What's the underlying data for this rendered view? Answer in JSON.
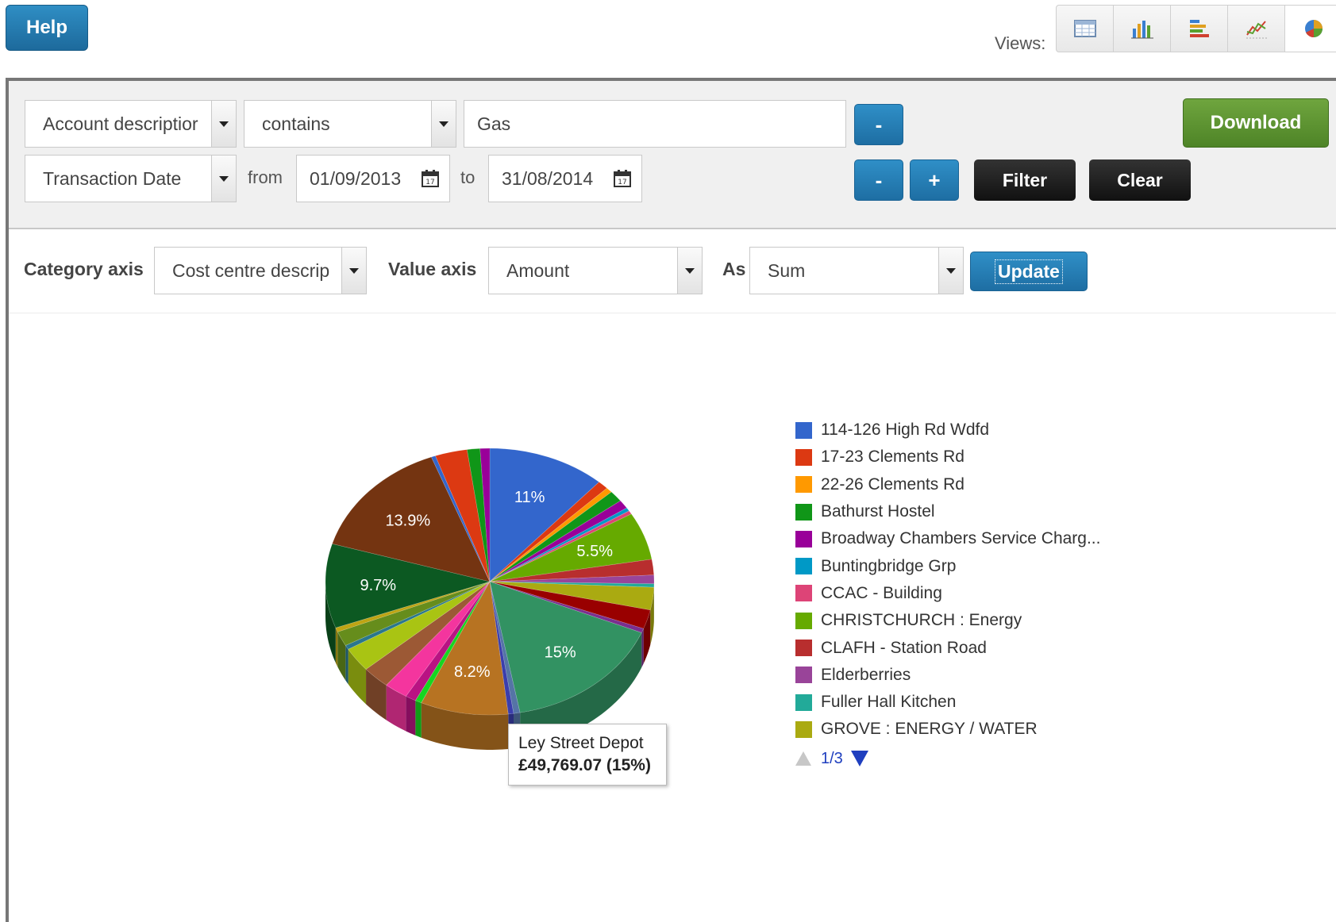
{
  "toolbar": {
    "help_label": "Help",
    "views_label": "Views:",
    "views": [
      "table-view-icon",
      "bar-chart-icon",
      "stacked-bar-icon",
      "line-chart-icon",
      "pie-chart-icon"
    ]
  },
  "filters": {
    "row1": {
      "field": "Account descriptior",
      "operator": "contains",
      "value": "Gas",
      "remove_label": "-"
    },
    "row2": {
      "field": "Transaction Date",
      "from_label": "from",
      "from_date": "01/09/2013",
      "to_label": "to",
      "to_date": "31/08/2014",
      "remove_label": "-",
      "add_label": "+",
      "filter_label": "Filter",
      "clear_label": "Clear"
    },
    "download_label": "Download"
  },
  "axes": {
    "category_label": "Category axis",
    "category_value": "Cost centre descrip",
    "value_label": "Value axis",
    "value_value": "Amount",
    "as_label": "As",
    "as_value": "Sum",
    "update_label": "Update"
  },
  "chart_data": {
    "type": "pie",
    "title": "",
    "slices": [
      {
        "name": "114-126 High Rd Wdfd",
        "percent": 11.0,
        "color": "#3366cc",
        "label": "11%"
      },
      {
        "name": "17-23 Clements Rd",
        "percent": 1.0,
        "color": "#dc3912",
        "label": ""
      },
      {
        "name": "22-26 Clements Rd",
        "percent": 0.6,
        "color": "#ff9900",
        "label": ""
      },
      {
        "name": "Bathurst Hostel",
        "percent": 1.3,
        "color": "#109618",
        "label": ""
      },
      {
        "name": "Broadway Chambers Service Charg...",
        "percent": 1.0,
        "color": "#990099",
        "label": ""
      },
      {
        "name": "Buntingbridge Grp",
        "percent": 0.4,
        "color": "#0099c6",
        "label": ""
      },
      {
        "name": "CCAC - Building",
        "percent": 0.4,
        "color": "#dd4477",
        "label": ""
      },
      {
        "name": "CHRISTCHURCH : Energy",
        "percent": 5.5,
        "color": "#66aa00",
        "label": "5.5%"
      },
      {
        "name": "CLAFH - Station Road",
        "percent": 1.8,
        "color": "#b82e2e",
        "label": ""
      },
      {
        "name": "Elderberries",
        "percent": 1.0,
        "color": "#994499",
        "label": ""
      },
      {
        "name": "Fuller Hall Kitchen",
        "percent": 0.4,
        "color": "#22aa99",
        "label": ""
      },
      {
        "name": "GROVE : ENERGY / WATER",
        "percent": 2.6,
        "color": "#aaaa11",
        "label": ""
      },
      {
        "name": "",
        "percent": 2.2,
        "color": "#990000",
        "label": ""
      },
      {
        "name": "",
        "percent": 0.5,
        "color": "#7a2f8f",
        "label": ""
      },
      {
        "name": "Ley Street Depot",
        "percent": 15.0,
        "color": "#329262",
        "label": "15%"
      },
      {
        "name": "",
        "percent": 0.6,
        "color": "#5574a6",
        "label": ""
      },
      {
        "name": "",
        "percent": 0.5,
        "color": "#3b3eac",
        "label": ""
      },
      {
        "name": "",
        "percent": 8.2,
        "color": "#b77322",
        "label": "8.2%"
      },
      {
        "name": "",
        "percent": 0.6,
        "color": "#16d620",
        "label": ""
      },
      {
        "name": "",
        "percent": 1.0,
        "color": "#b91383",
        "label": ""
      },
      {
        "name": "",
        "percent": 2.2,
        "color": "#f4359e",
        "label": ""
      },
      {
        "name": "",
        "percent": 2.6,
        "color": "#9c5935",
        "label": ""
      },
      {
        "name": "",
        "percent": 2.8,
        "color": "#a9c413",
        "label": ""
      },
      {
        "name": "",
        "percent": 0.5,
        "color": "#2a778d",
        "label": ""
      },
      {
        "name": "",
        "percent": 1.7,
        "color": "#668d1c",
        "label": ""
      },
      {
        "name": "",
        "percent": 0.5,
        "color": "#bea413",
        "label": ""
      },
      {
        "name": "",
        "percent": 9.7,
        "color": "#0c5922",
        "label": "9.7%"
      },
      {
        "name": "",
        "percent": 13.9,
        "color": "#743411",
        "label": "13.9%"
      },
      {
        "name": "",
        "percent": 0.4,
        "color": "#3366cc",
        "label": ""
      },
      {
        "name": "",
        "percent": 3.0,
        "color": "#dc3912",
        "label": ""
      },
      {
        "name": "",
        "percent": 1.2,
        "color": "#109618",
        "label": ""
      },
      {
        "name": "",
        "percent": 0.9,
        "color": "#990099",
        "label": ""
      }
    ],
    "legend": {
      "items": [
        {
          "name": "114-126 High Rd Wdfd",
          "color": "#3366cc"
        },
        {
          "name": "17-23 Clements Rd",
          "color": "#dc3912"
        },
        {
          "name": "22-26 Clements Rd",
          "color": "#ff9900"
        },
        {
          "name": "Bathurst Hostel",
          "color": "#109618"
        },
        {
          "name": "Broadway Chambers Service Charg...",
          "color": "#990099"
        },
        {
          "name": "Buntingbridge Grp",
          "color": "#0099c6"
        },
        {
          "name": "CCAC - Building",
          "color": "#dd4477"
        },
        {
          "name": "CHRISTCHURCH : Energy",
          "color": "#66aa00"
        },
        {
          "name": "CLAFH - Station Road",
          "color": "#b82e2e"
        },
        {
          "name": "Elderberries",
          "color": "#994499"
        },
        {
          "name": "Fuller Hall Kitchen",
          "color": "#22aa99"
        },
        {
          "name": "GROVE : ENERGY / WATER",
          "color": "#aaaa11"
        }
      ],
      "page": "1/3",
      "placement": "right"
    },
    "tooltip": {
      "name": "Ley Street Depot",
      "value": "£49,769.07 (15%)"
    }
  }
}
